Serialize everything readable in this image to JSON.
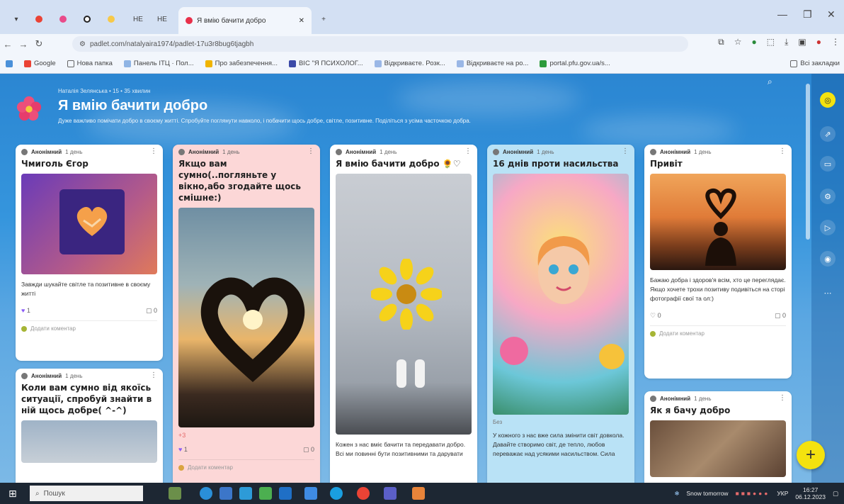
{
  "browser": {
    "active_tab_title": "Я вмію бачити добро",
    "small_tabs": [
      "G",
      "",
      "O",
      "",
      "НЕ",
      "НЕ"
    ],
    "url": "padlet.com/natalyaira1974/padlet-17u3r8bug6tjagbh",
    "bookmarks": [
      "Google",
      "Нова папка",
      "Панель ІТЦ · Пол...",
      "Про забезпечення...",
      "ВІС \"Я ПСИХОЛОГ...",
      "Відкриваєте. Розк...",
      "Відкриваєте на ро...",
      "portal.pfu.gov.ua/s..."
    ],
    "bookmarks_right": "Всі закладки"
  },
  "board": {
    "meta": "Наталія Зелянська • 15 • 35 хвилин",
    "title": "Я вмію бачити добро",
    "description": "Дуже важливо помічати добро в своєму житті. Спробуйте поглянути навколо, і побачити щось добре, світле, позитивне. Поділіться з усіма часточкою добра."
  },
  "cards": [
    {
      "author": "Анонімний",
      "time": "1 день",
      "title": "Чмиголь Єгор",
      "text": "Завжди шукайте світле та позитивне в своєму житті",
      "likes": "1",
      "comments": "0",
      "comment_placeholder": "Додати коментар"
    },
    {
      "author": "Анонімний",
      "time": "1 день",
      "title": "Коли вам сумно від якоїсь ситуації, спробуй знайти в ній щось добре(   ^-^)"
    },
    {
      "author": "Анонімний",
      "time": "1 день",
      "title": "Якщо вам сумно(..погляньте у вікно,або згодайте щось смішне:)",
      "extra": "+3",
      "likes": "1",
      "comments": "0",
      "comment_placeholder": "Додати коментар"
    },
    {
      "author": "Анонімний",
      "time": "1 день",
      "title": "Я вмію бачити добро 🌻♡",
      "text": "Кожен з нас вміє бачити та передавати добро. Всі ми повинні бути позитивними та дарувати"
    },
    {
      "author": "Анонімний",
      "time": "1 день",
      "title": "16 днів проти насильства",
      "label": "Без",
      "text": "У кожного з нас вже сила змінити світ довкола. Давайте створимо світ, де тепло, любов переважає над усякими насильством. Сила"
    },
    {
      "author": "Анонімний",
      "time": "1 день",
      "title": "Привіт",
      "text": "Бажаю добра і здоров'я всім, хто це переглядає. Якщо хочете трохи позитиву подивіться на сторі фотографії свої та ол:)",
      "likes": "0",
      "comments": "0",
      "comment_placeholder": "Додати коментар"
    },
    {
      "author": "Анонімний",
      "time": "1 день",
      "title": "Як я бачу добро"
    }
  ],
  "fab_label": "+",
  "taskbar": {
    "search_placeholder": "Пошук",
    "weather": "Snow tomorrow",
    "lang": "УКР",
    "time": "16:27",
    "date": "06.12.2023"
  },
  "colors": {
    "accent": "#f4e20f",
    "pink_card": "#fcd7d7",
    "blue_card": "#b9e2f6",
    "bg_top": "#2b86d2"
  }
}
